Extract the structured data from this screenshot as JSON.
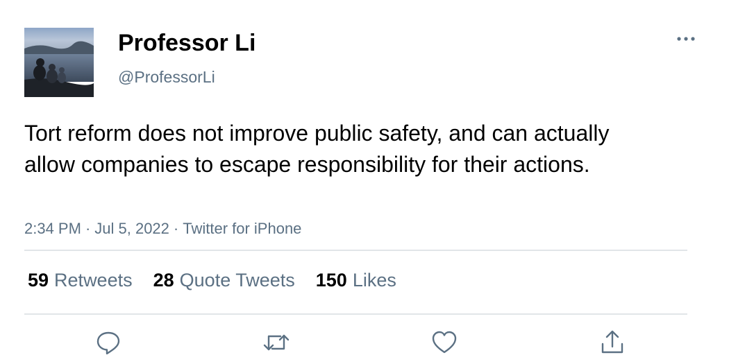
{
  "tweet": {
    "author": {
      "display_name": "Professor Li",
      "handle": "@ProfessorLi",
      "avatar_icon": "avatar-lakeside-photo"
    },
    "text": "Tort reform does not improve public safety, and can actually allow companies to escape responsibility for their actions.",
    "meta": {
      "time": "2:34 PM",
      "date": "Jul 5, 2022",
      "source": "Twitter for iPhone",
      "separator": "·"
    },
    "stats": [
      {
        "count": "59",
        "label": "Retweets"
      },
      {
        "count": "28",
        "label": "Quote Tweets"
      },
      {
        "count": "150",
        "label": "Likes"
      }
    ],
    "actions": [
      {
        "name": "reply",
        "icon": "reply-icon"
      },
      {
        "name": "retweet",
        "icon": "retweet-icon"
      },
      {
        "name": "like",
        "icon": "heart-icon"
      },
      {
        "name": "share",
        "icon": "share-icon"
      }
    ],
    "more_icon": "more-options-icon"
  },
  "colors": {
    "text": "#000000",
    "secondary": "#5b7083",
    "divider": "#e1e5e8",
    "icon": "#5b7083"
  }
}
